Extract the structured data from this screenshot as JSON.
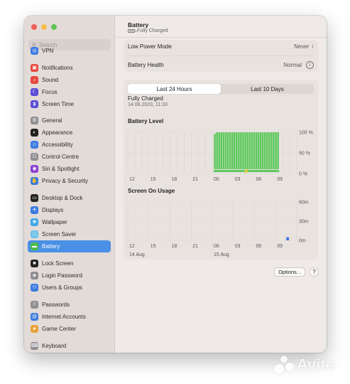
{
  "window": {
    "search_placeholder": "Search",
    "sidebar": {
      "items": [
        {
          "label": "VPN",
          "icon": "vpn-icon",
          "color": "#3b7be0",
          "top": 0
        },
        {
          "label": "Notifications",
          "icon": "notifications-icon",
          "color": "#e5483d",
          "top": 1
        },
        {
          "label": "Sound",
          "icon": "sound-icon",
          "color": "#e5483d",
          "top": 2
        },
        {
          "label": "Focus",
          "icon": "focus-icon",
          "color": "#5b4fd6",
          "top": 3
        },
        {
          "label": "Screen Time",
          "icon": "screen-time-icon",
          "color": "#5b4fd6",
          "top": 4
        },
        {
          "label": "General",
          "icon": "gear-icon",
          "color": "#8e8e93",
          "top": 5
        },
        {
          "label": "Appearance",
          "icon": "appearance-icon",
          "color": "#222222",
          "top": 6
        },
        {
          "label": "Accessibility",
          "icon": "accessibility-icon",
          "color": "#3b7be0",
          "top": 7
        },
        {
          "label": "Control Centre",
          "icon": "control-centre-icon",
          "color": "#8e8e93",
          "top": 8
        },
        {
          "label": "Siri & Spotlight",
          "icon": "siri-icon",
          "color": "#8a3fd1",
          "top": 9
        },
        {
          "label": "Privacy & Security",
          "icon": "hand-icon",
          "color": "#3b7be0",
          "top": 10
        },
        {
          "label": "Desktop & Dock",
          "icon": "desktop-icon",
          "color": "#222222",
          "top": 11
        },
        {
          "label": "Displays",
          "icon": "displays-icon",
          "color": "#3b7be0",
          "top": 12
        },
        {
          "label": "Wallpaper",
          "icon": "wallpaper-icon",
          "color": "#3fa8e8",
          "top": 13
        },
        {
          "label": "Screen Saver",
          "icon": "screen-saver-icon",
          "color": "#6ec3e8",
          "top": 14
        },
        {
          "label": "Battery",
          "icon": "battery-icon",
          "color": "#4cbb4a",
          "top": 15,
          "active": true
        },
        {
          "label": "Lock Screen",
          "icon": "lock-icon",
          "color": "#222222",
          "top": 16
        },
        {
          "label": "Login Password",
          "icon": "key-icon",
          "color": "#8e8e93",
          "top": 17
        },
        {
          "label": "Users & Groups",
          "icon": "users-icon",
          "color": "#3b7be0",
          "top": 18
        },
        {
          "label": "Passwords",
          "icon": "passwords-icon",
          "color": "#8e8e93",
          "top": 19
        },
        {
          "label": "Internet Accounts",
          "icon": "at-icon",
          "color": "#3b7be0",
          "top": 20
        },
        {
          "label": "Game Center",
          "icon": "game-center-icon",
          "color": "#e8a33b",
          "top": 21
        },
        {
          "label": "Keyboard",
          "icon": "keyboard-icon",
          "color": "#8e8e93",
          "top": 22
        }
      ]
    },
    "header": {
      "title": "Battery",
      "subtitle": "Fully Charged"
    },
    "settings": {
      "low_power_label": "Low Power Mode",
      "low_power_value": "Never",
      "health_label": "Battery Health",
      "health_value": "Normal"
    },
    "tabs": {
      "tab1": "Last 24 Hours",
      "tab2": "Last 10 Days"
    },
    "status": {
      "title": "Fully Charged",
      "date": "14.06.2023, 11:33"
    },
    "buttons": {
      "options": "Options...",
      "help": "?"
    }
  },
  "chart_data": [
    {
      "type": "bar",
      "title": "Battery Level",
      "x_ticks": [
        "12",
        "15",
        "18",
        "21",
        "00",
        "03",
        "06",
        "09"
      ],
      "y_ticks": [
        "100 %",
        "50 %",
        "0 %"
      ],
      "ylim": [
        0,
        100
      ],
      "series": [
        {
          "color": "#5bc95a",
          "start_hour": 0,
          "bar_count": 30,
          "values": [
            96,
            100,
            100,
            100,
            100,
            100,
            100,
            100,
            100,
            100,
            100,
            100,
            100,
            100,
            100,
            100,
            100,
            100,
            100,
            100,
            100,
            100,
            100,
            100,
            100,
            100,
            100,
            100,
            100,
            100
          ]
        }
      ],
      "charging": true
    },
    {
      "type": "bar",
      "title": "Screen On Usage",
      "x_ticks": [
        "12",
        "15",
        "18",
        "21",
        "00",
        "03",
        "06",
        "09"
      ],
      "x_date_labels": [
        "14 Aug",
        "15 Aug"
      ],
      "y_ticks": [
        "60m",
        "30m",
        "0m"
      ],
      "ylim": [
        0,
        60
      ],
      "series": [
        {
          "color": "#3b7be0",
          "values": [
            {
              "hour": 10.5,
              "minutes": 5
            }
          ]
        }
      ]
    }
  ],
  "watermark": "Avito"
}
